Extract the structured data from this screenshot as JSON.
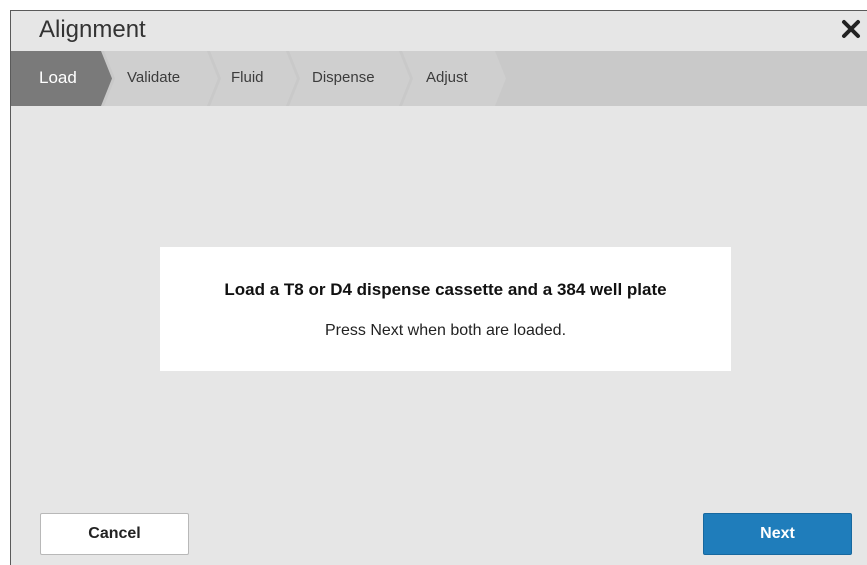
{
  "dialog": {
    "title": "Alignment",
    "close_icon": "close-icon"
  },
  "steps": [
    {
      "label": "Load",
      "active": true
    },
    {
      "label": "Validate",
      "active": false
    },
    {
      "label": "Fluid",
      "active": false
    },
    {
      "label": "Dispense",
      "active": false
    },
    {
      "label": "Adjust",
      "active": false
    }
  ],
  "card": {
    "heading": "Load a T8 or D4 dispense cassette and a 384 well plate",
    "instruction": "Press Next when both are loaded."
  },
  "footer": {
    "cancel_label": "Cancel",
    "next_label": "Next"
  },
  "colors": {
    "active_step": "#7a7a7a",
    "inactive_step": "#cfcfcf",
    "primary_button": "#1f7dbb",
    "dialog_background": "#e6e6e6"
  }
}
